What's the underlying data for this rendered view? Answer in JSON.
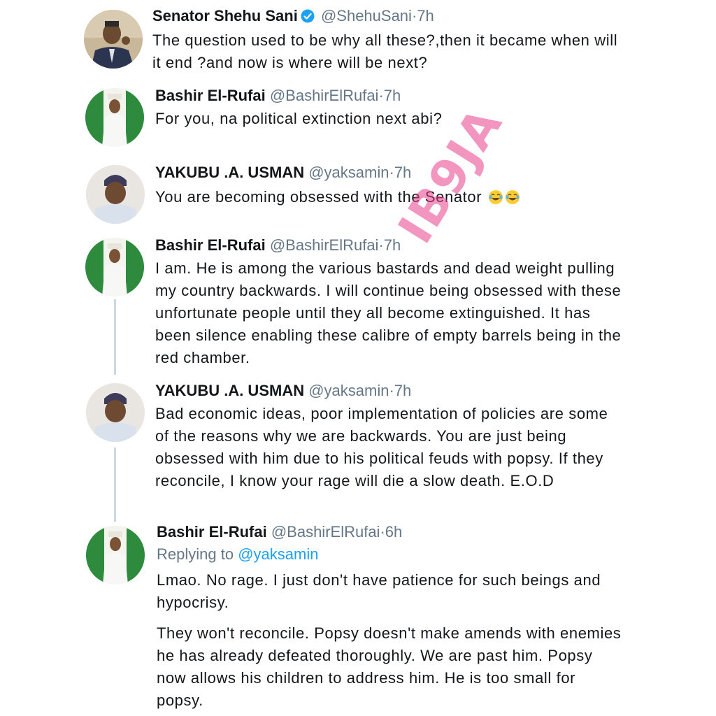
{
  "tweets": [
    {
      "name": "Senator Shehu Sani",
      "handle": "@ShehuSani",
      "separator": "·",
      "time": "7h",
      "verified": true,
      "text": "The question used to be why all these?,then it became when will it end ?and now is where will be next?"
    },
    {
      "name": "Bashir El-Rufai",
      "handle": "@BashirElRufai",
      "separator": "·",
      "time": "7h",
      "text": "For you, na political extinction next abi?"
    },
    {
      "name": "YAKUBU .A. USMAN",
      "handle": "@yaksamin",
      "separator": "·",
      "time": "7h",
      "text": "You are becoming obsessed with the Senator",
      "emoji": "face-with-tears-of-joy x2"
    },
    {
      "name": "Bashir El-Rufai",
      "handle": "@BashirElRufai",
      "separator": "·",
      "time": "7h",
      "text": "I am. He is among the various bastards and dead weight pulling my country backwards. I will continue being obsessed with these unfortunate people until they all become extinguished. It has been silence enabling these calibre of empty barrels being in the red chamber."
    },
    {
      "name": "YAKUBU .A. USMAN",
      "handle": "@yaksamin",
      "separator": "·",
      "time": "7h",
      "text": "Bad economic ideas, poor implementation of policies are some of the reasons why we are backwards. You are just being obsessed with him due to his political feuds with popsy. If they reconcile, I know your rage will die a slow death. E.O.D"
    },
    {
      "name": "Bashir El-Rufai",
      "handle": "@BashirElRufai",
      "separator": "·",
      "time": "6h",
      "replying_prefix": "Replying to",
      "replying_to": "@yaksamin",
      "text": "Lmao. No rage. I just don't have patience for such beings and hypocrisy.",
      "text2": "They won't reconcile. Popsy doesn't make amends with enemies he has already defeated thoroughly. We are past him. Popsy now allows his children to address him. He is too small for popsy."
    }
  ],
  "watermark": "IB9JA",
  "colors": {
    "name": "#14171a",
    "meta": "#657786",
    "link": "#1da1f2",
    "thread_line": "#ccd6dd",
    "watermark": "#e8408c"
  },
  "icons": {
    "verified": "verified-badge-icon",
    "emoji": "face-with-tears-of-joy-icon"
  }
}
